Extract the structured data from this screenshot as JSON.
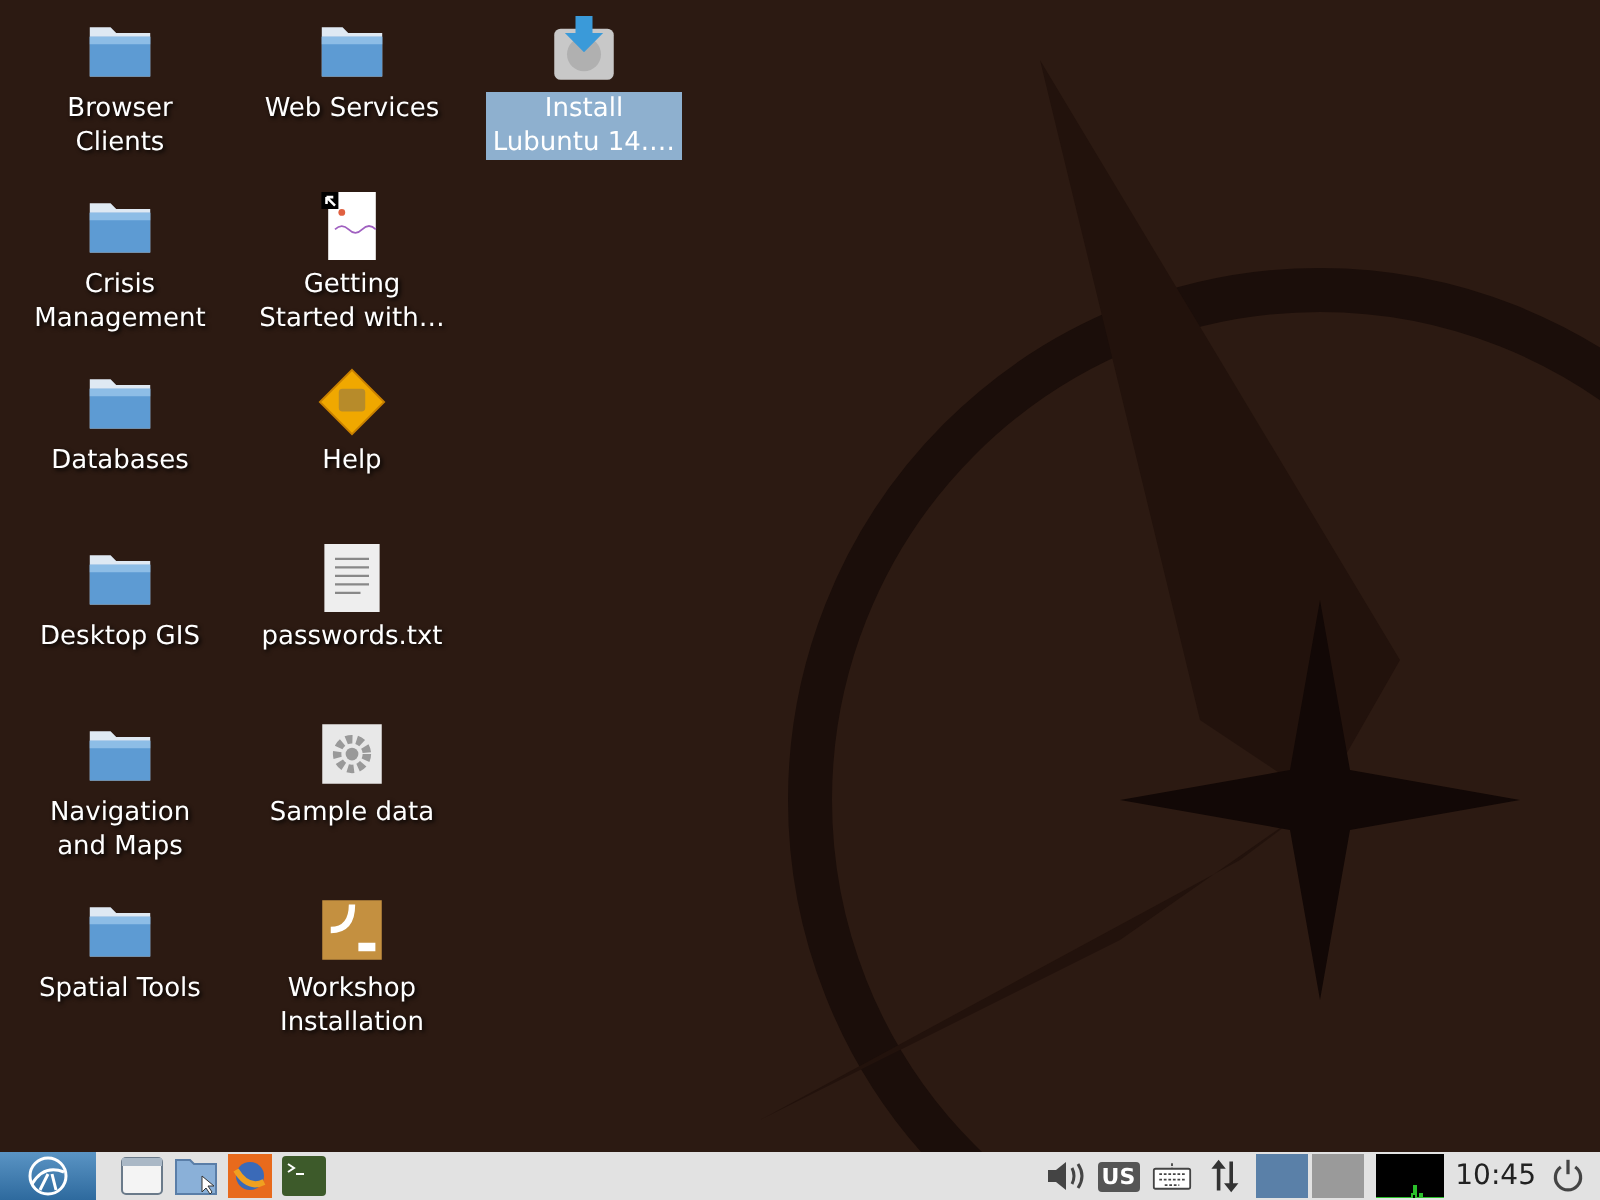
{
  "desktop": {
    "icons": [
      {
        "label": "Browser Clients",
        "kind": "folder",
        "selected": false
      },
      {
        "label": "Crisis Management",
        "kind": "folder",
        "selected": false
      },
      {
        "label": "Databases",
        "kind": "folder",
        "selected": false
      },
      {
        "label": "Desktop GIS",
        "kind": "folder",
        "selected": false
      },
      {
        "label": "Navigation and Maps",
        "kind": "folder",
        "selected": false
      },
      {
        "label": "Spatial Tools",
        "kind": "folder",
        "selected": false
      },
      {
        "label": "Web Services",
        "kind": "folder",
        "selected": false
      },
      {
        "label": "Getting Started with…",
        "kind": "document",
        "selected": false
      },
      {
        "label": "Help",
        "kind": "help",
        "selected": false
      },
      {
        "label": "passwords.txt",
        "kind": "text",
        "selected": false
      },
      {
        "label": "Sample data",
        "kind": "settings",
        "selected": false
      },
      {
        "label": "Workshop Installation",
        "kind": "package",
        "selected": false
      },
      {
        "label": "Install Lubuntu 14.…",
        "kind": "installer",
        "selected": true
      }
    ]
  },
  "taskbar": {
    "launchers": [
      {
        "kind": "window"
      },
      {
        "kind": "files"
      },
      {
        "kind": "browser"
      },
      {
        "kind": "terminal"
      }
    ],
    "keyboard_layout": "US",
    "workspaces": [
      {
        "selected": true
      },
      {
        "selected": false
      }
    ],
    "clock": "10:45"
  }
}
